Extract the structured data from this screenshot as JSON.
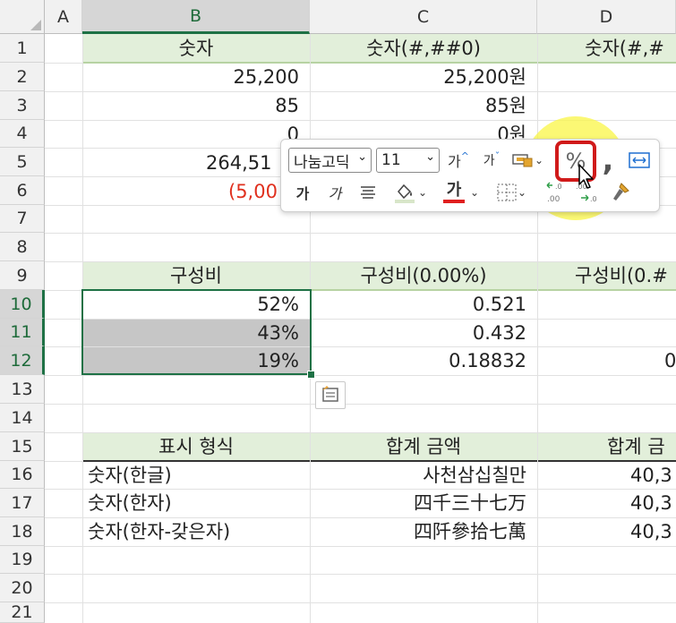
{
  "columns": [
    {
      "letter": "A"
    },
    {
      "letter": "B"
    },
    {
      "letter": "C"
    },
    {
      "letter": "D"
    }
  ],
  "rows": [
    "1",
    "2",
    "3",
    "4",
    "5",
    "6",
    "7",
    "8",
    "9",
    "10",
    "11",
    "12",
    "13",
    "14",
    "15",
    "16",
    "17",
    "18",
    "19",
    "20",
    "21"
  ],
  "selected_rows": [
    "10",
    "11",
    "12"
  ],
  "selected_column": "B",
  "cells": {
    "B1": "숫자",
    "C1": "숫자(#,##0)",
    "D1": "숫자(#,#",
    "B2": "25,200",
    "C2": "25,200원",
    "B3": "85",
    "C3": "85원",
    "B4": "0",
    "C4": "0원",
    "B5": "264,51",
    "B6": "(5,00",
    "B9": "구성비",
    "C9": "구성비(0.00%)",
    "D9": "구성비(0.#",
    "B10": "52%",
    "C10": "0.521",
    "B11": "43%",
    "C11": "0.432",
    "B12": "19%",
    "C12": "0.18832",
    "D12": "0",
    "B15": "표시 형식",
    "C15": "합계 금액",
    "D15": "합계 금",
    "B16": "숫자(한글)",
    "C16": "사천삼십칠만",
    "D16": "40,3",
    "B17": "숫자(한자)",
    "C17": "四千三十七万",
    "D17": "40,3",
    "B18": "숫자(한자-갖은자)",
    "C18": "四阡參拾七萬",
    "D18": "40,3"
  },
  "mini_toolbar": {
    "font_name": "나눔고딕",
    "font_size": "11",
    "increase_font": "가",
    "decrease_font": "가",
    "bold": "가",
    "italic": "가",
    "font_color_glyph": "가",
    "percent_style": "%",
    "comma_style": ",",
    "increase_decimal": ".0\n.00",
    "decrease_decimal": ".00\n.0",
    "format_painter": "format-painter-icon"
  },
  "colors": {
    "header_band": "#e2efda",
    "selection": "#1e7145",
    "negative": "#e0301e",
    "highlight": "#faf646",
    "callout": "#d01a1a"
  }
}
